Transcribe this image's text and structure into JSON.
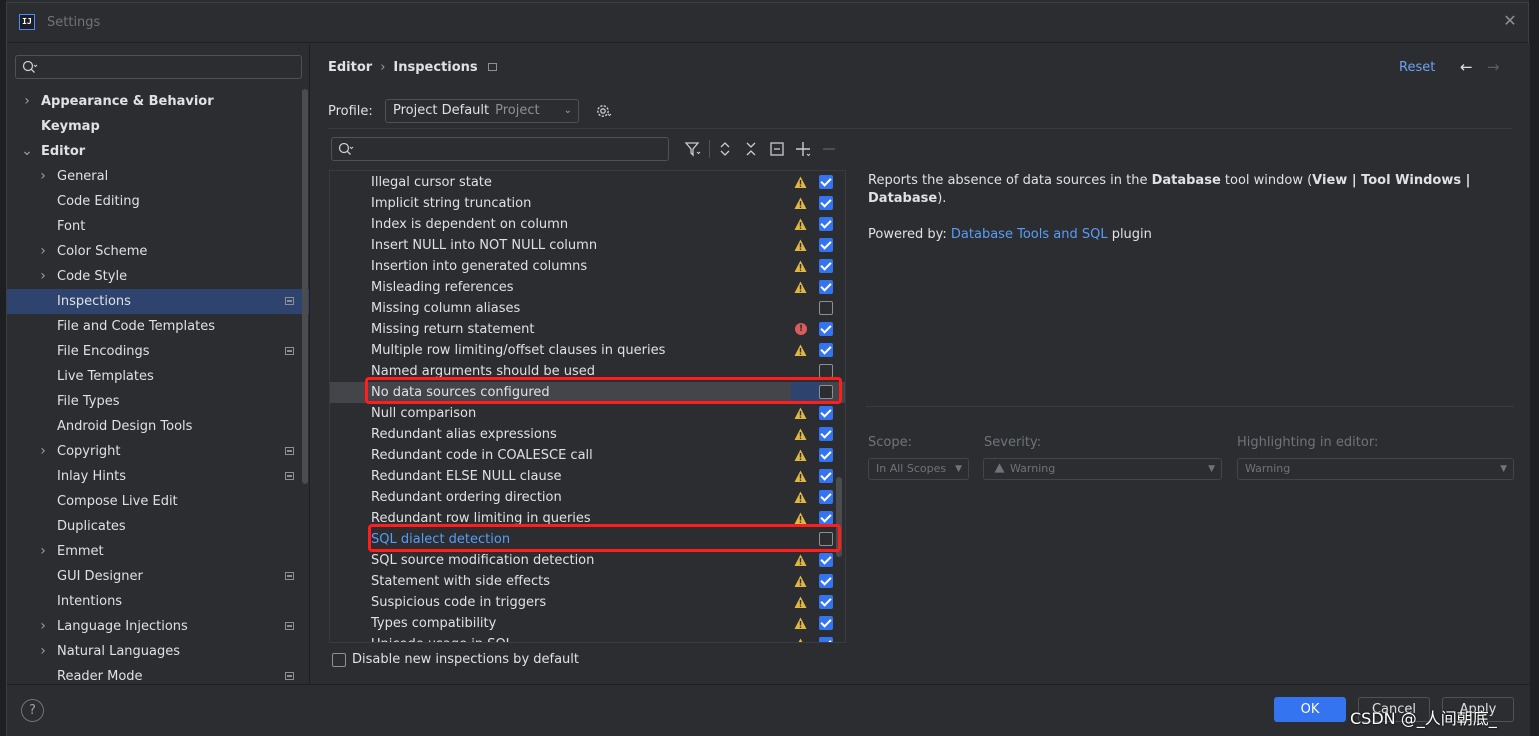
{
  "window": {
    "title": "Settings"
  },
  "sidebar": {
    "search_placeholder": "",
    "items": [
      {
        "label": "Appearance & Behavior",
        "level": 0,
        "expandable": true,
        "expanded": false,
        "bold": true,
        "project": false,
        "selected": false
      },
      {
        "label": "Keymap",
        "level": 0,
        "expandable": false,
        "bold": true,
        "project": false,
        "selected": false
      },
      {
        "label": "Editor",
        "level": 0,
        "expandable": true,
        "expanded": true,
        "bold": true,
        "project": false,
        "selected": false
      },
      {
        "label": "General",
        "level": 1,
        "expandable": true,
        "expanded": false,
        "project": false,
        "selected": false
      },
      {
        "label": "Code Editing",
        "level": 1,
        "expandable": false,
        "project": false,
        "selected": false
      },
      {
        "label": "Font",
        "level": 1,
        "expandable": false,
        "project": false,
        "selected": false
      },
      {
        "label": "Color Scheme",
        "level": 1,
        "expandable": true,
        "expanded": false,
        "project": false,
        "selected": false
      },
      {
        "label": "Code Style",
        "level": 1,
        "expandable": true,
        "expanded": false,
        "project": false,
        "selected": false
      },
      {
        "label": "Inspections",
        "level": 1,
        "expandable": false,
        "project": true,
        "selected": true
      },
      {
        "label": "File and Code Templates",
        "level": 1,
        "expandable": false,
        "project": false,
        "selected": false
      },
      {
        "label": "File Encodings",
        "level": 1,
        "expandable": false,
        "project": true,
        "selected": false
      },
      {
        "label": "Live Templates",
        "level": 1,
        "expandable": false,
        "project": false,
        "selected": false
      },
      {
        "label": "File Types",
        "level": 1,
        "expandable": false,
        "project": false,
        "selected": false
      },
      {
        "label": "Android Design Tools",
        "level": 1,
        "expandable": false,
        "project": false,
        "selected": false
      },
      {
        "label": "Copyright",
        "level": 1,
        "expandable": true,
        "expanded": false,
        "project": true,
        "selected": false
      },
      {
        "label": "Inlay Hints",
        "level": 1,
        "expandable": false,
        "project": true,
        "selected": false
      },
      {
        "label": "Compose Live Edit",
        "level": 1,
        "expandable": false,
        "project": false,
        "selected": false
      },
      {
        "label": "Duplicates",
        "level": 1,
        "expandable": false,
        "project": false,
        "selected": false
      },
      {
        "label": "Emmet",
        "level": 1,
        "expandable": true,
        "expanded": false,
        "project": false,
        "selected": false
      },
      {
        "label": "GUI Designer",
        "level": 1,
        "expandable": false,
        "project": true,
        "selected": false
      },
      {
        "label": "Intentions",
        "level": 1,
        "expandable": false,
        "project": false,
        "selected": false
      },
      {
        "label": "Language Injections",
        "level": 1,
        "expandable": true,
        "expanded": false,
        "project": true,
        "selected": false
      },
      {
        "label": "Natural Languages",
        "level": 1,
        "expandable": true,
        "expanded": false,
        "project": false,
        "selected": false
      },
      {
        "label": "Reader Mode",
        "level": 1,
        "expandable": false,
        "project": true,
        "selected": false
      }
    ]
  },
  "header": {
    "breadcrumb": [
      "Editor",
      "Inspections"
    ],
    "reset_label": "Reset",
    "back_icon": "arrow-left-icon",
    "forward_icon": "arrow-right-icon"
  },
  "profile": {
    "label": "Profile:",
    "name": "Project Default",
    "scope": "Project"
  },
  "toolbar": {
    "search_placeholder": "",
    "buttons": [
      "filter-icon",
      "expand-all-icon",
      "collapse-all-icon",
      "copy-icon",
      "add-icon",
      "remove-icon"
    ]
  },
  "inspections": [
    {
      "name": "Illegal cursor state",
      "severity": "warning",
      "enabled": true,
      "selected": false,
      "link": false
    },
    {
      "name": "Implicit string truncation",
      "severity": "warning",
      "enabled": true,
      "selected": false,
      "link": false
    },
    {
      "name": "Index is dependent on column",
      "severity": "warning",
      "enabled": true,
      "selected": false,
      "link": false
    },
    {
      "name": "Insert NULL into NOT NULL column",
      "severity": "warning",
      "enabled": true,
      "selected": false,
      "link": false
    },
    {
      "name": "Insertion into generated columns",
      "severity": "warning",
      "enabled": true,
      "selected": false,
      "link": false
    },
    {
      "name": "Misleading references",
      "severity": "warning",
      "enabled": true,
      "selected": false,
      "link": false
    },
    {
      "name": "Missing column aliases",
      "severity": "none",
      "enabled": false,
      "selected": false,
      "link": false
    },
    {
      "name": "Missing return statement",
      "severity": "error",
      "enabled": true,
      "selected": false,
      "link": false
    },
    {
      "name": "Multiple row limiting/offset clauses in queries",
      "severity": "warning",
      "enabled": true,
      "selected": false,
      "link": false
    },
    {
      "name": "Named arguments should be used",
      "severity": "none",
      "enabled": false,
      "selected": false,
      "link": false
    },
    {
      "name": "No data sources configured",
      "severity": "none",
      "enabled": false,
      "selected": true,
      "link": false
    },
    {
      "name": "Null comparison",
      "severity": "warning",
      "enabled": true,
      "selected": false,
      "link": false
    },
    {
      "name": "Redundant alias expressions",
      "severity": "warning",
      "enabled": true,
      "selected": false,
      "link": false
    },
    {
      "name": "Redundant code in COALESCE call",
      "severity": "warning",
      "enabled": true,
      "selected": false,
      "link": false
    },
    {
      "name": "Redundant ELSE NULL clause",
      "severity": "warning",
      "enabled": true,
      "selected": false,
      "link": false
    },
    {
      "name": "Redundant ordering direction",
      "severity": "warning",
      "enabled": true,
      "selected": false,
      "link": false
    },
    {
      "name": "Redundant row limiting in queries",
      "severity": "warning",
      "enabled": true,
      "selected": false,
      "link": false
    },
    {
      "name": "SQL dialect detection",
      "severity": "none",
      "enabled": false,
      "selected": false,
      "link": true
    },
    {
      "name": "SQL source modification detection",
      "severity": "warning",
      "enabled": true,
      "selected": false,
      "link": false
    },
    {
      "name": "Statement with side effects",
      "severity": "warning",
      "enabled": true,
      "selected": false,
      "link": false
    },
    {
      "name": "Suspicious code in triggers",
      "severity": "warning",
      "enabled": true,
      "selected": false,
      "link": false
    },
    {
      "name": "Types compatibility",
      "severity": "warning",
      "enabled": true,
      "selected": false,
      "link": false
    },
    {
      "name": "Unicode usage in SQL",
      "severity": "warning",
      "enabled": true,
      "selected": false,
      "link": false
    }
  ],
  "disable_new": {
    "label": "Disable new inspections by default",
    "checked": false
  },
  "description": {
    "line1_pre": "Reports the absence of data sources in the ",
    "line1_b1": "Database",
    "line1_mid": " tool window (",
    "line1_b2": "View | Tool Windows | Database",
    "line1_end": ").",
    "powered_pre": "Powered by: ",
    "powered_link": "Database Tools and SQL",
    "powered_post": " plugin"
  },
  "options": {
    "scope_label": "Scope:",
    "scope_value": "In All Scopes",
    "severity_label": "Severity:",
    "severity_value": "Warning",
    "highlight_label": "Highlighting in editor:",
    "highlight_value": "Warning"
  },
  "footer": {
    "help": "?",
    "ok": "OK",
    "cancel": "Cancel",
    "apply": "Apply"
  },
  "watermark": "CSDN @_人间朝底_",
  "colors": {
    "accent": "#3574f0",
    "selection": "#2e436e",
    "link": "#589df6",
    "warning": "#e0b740",
    "error": "#db5c5c",
    "highlight_box": "#ff1d1d"
  }
}
